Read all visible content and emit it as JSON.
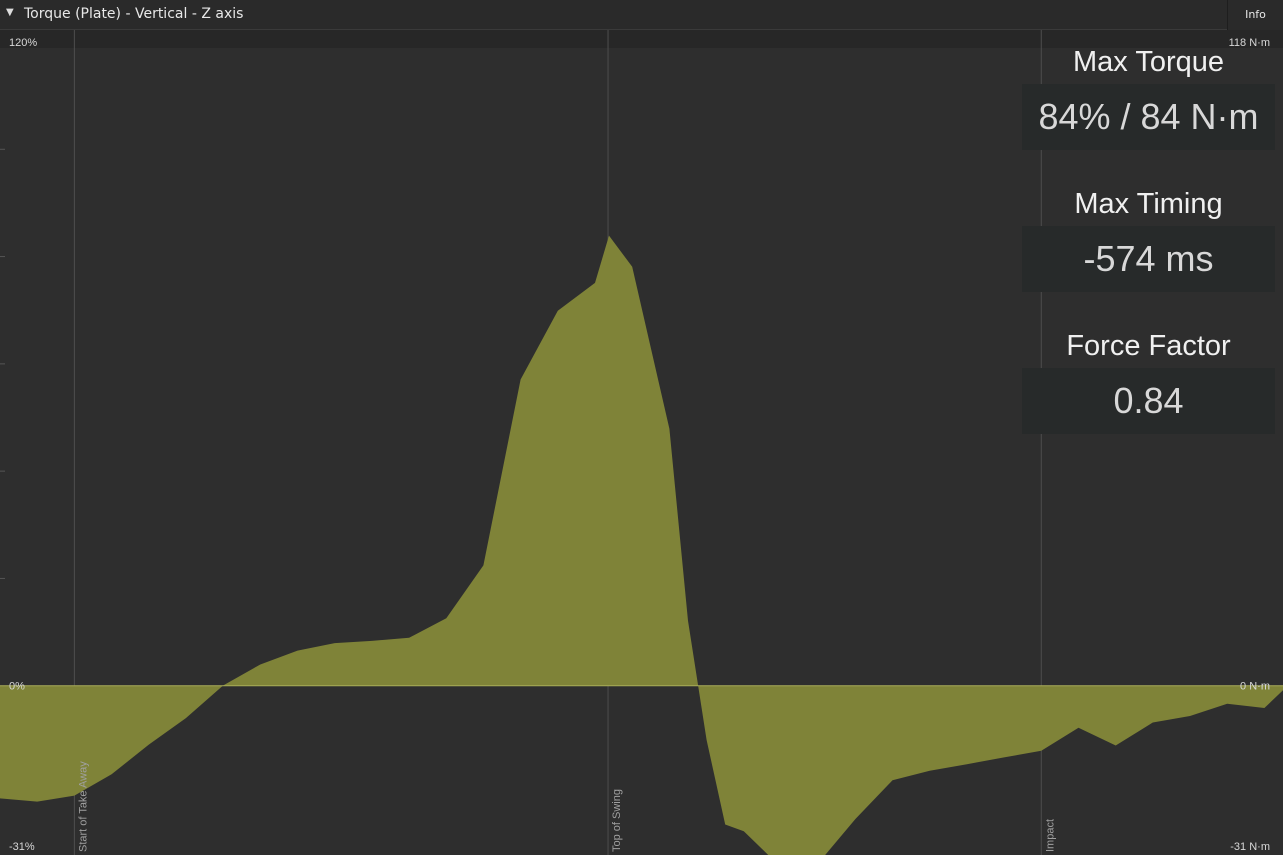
{
  "header": {
    "title": "Torque (Plate) - Vertical - Z axis",
    "info_label": "Info",
    "caret_icon": "caret-down-icon"
  },
  "stats": [
    {
      "label": "Max Torque",
      "value": "84% / 84 N·m"
    },
    {
      "label": "Max Timing",
      "value": "-574 ms"
    },
    {
      "label": "Force Factor",
      "value": "0.84"
    }
  ],
  "colors": {
    "fill": "#7f8338",
    "zero_line": "#a8ac58",
    "background": "#2e2e2e",
    "event_line": "#4e4e4e"
  },
  "chart_data": {
    "type": "area",
    "title": "Torque (Plate) - Vertical - Z axis",
    "xlabel": "",
    "ylabel": "",
    "ylim": [
      -31,
      120
    ],
    "y_unit": "%",
    "left_axis_labels": {
      "top": "120%",
      "zero": "0%",
      "bottom": "-31%"
    },
    "right_axis_labels": {
      "top": "118 N·m",
      "zero": "0 N·m",
      "bottom": "-31 N·m"
    },
    "events": [
      {
        "name": "Start of Take Away",
        "x": 0
      },
      {
        "name": "Top of Swing",
        "x": 574
      },
      {
        "name": "Impact",
        "x": 1040
      }
    ],
    "xlim": [
      -80,
      1300
    ],
    "series": [
      {
        "x": [
          -80,
          -40,
          0,
          40,
          80,
          120,
          160,
          200,
          240,
          280,
          320,
          360,
          400,
          440,
          480,
          520,
          560,
          575,
          600,
          640,
          660,
          680,
          700,
          720,
          760,
          800,
          840,
          880,
          920,
          960,
          1000,
          1040,
          1080,
          1120,
          1160,
          1200,
          1240,
          1280,
          1300
        ],
        "values": [
          -21,
          -21.6,
          -20.5,
          -16.5,
          -11,
          -6,
          0,
          4,
          6.5,
          8,
          8.3,
          9,
          12.5,
          22.5,
          57,
          70,
          75,
          84,
          78,
          48,
          12,
          -10,
          -26,
          -27,
          -34,
          -33,
          -25,
          -17.5,
          -16,
          -14.5,
          -13.5,
          -12,
          -8,
          -11,
          -7,
          -5.5,
          -3.5,
          -4,
          -1
        ]
      }
    ]
  }
}
